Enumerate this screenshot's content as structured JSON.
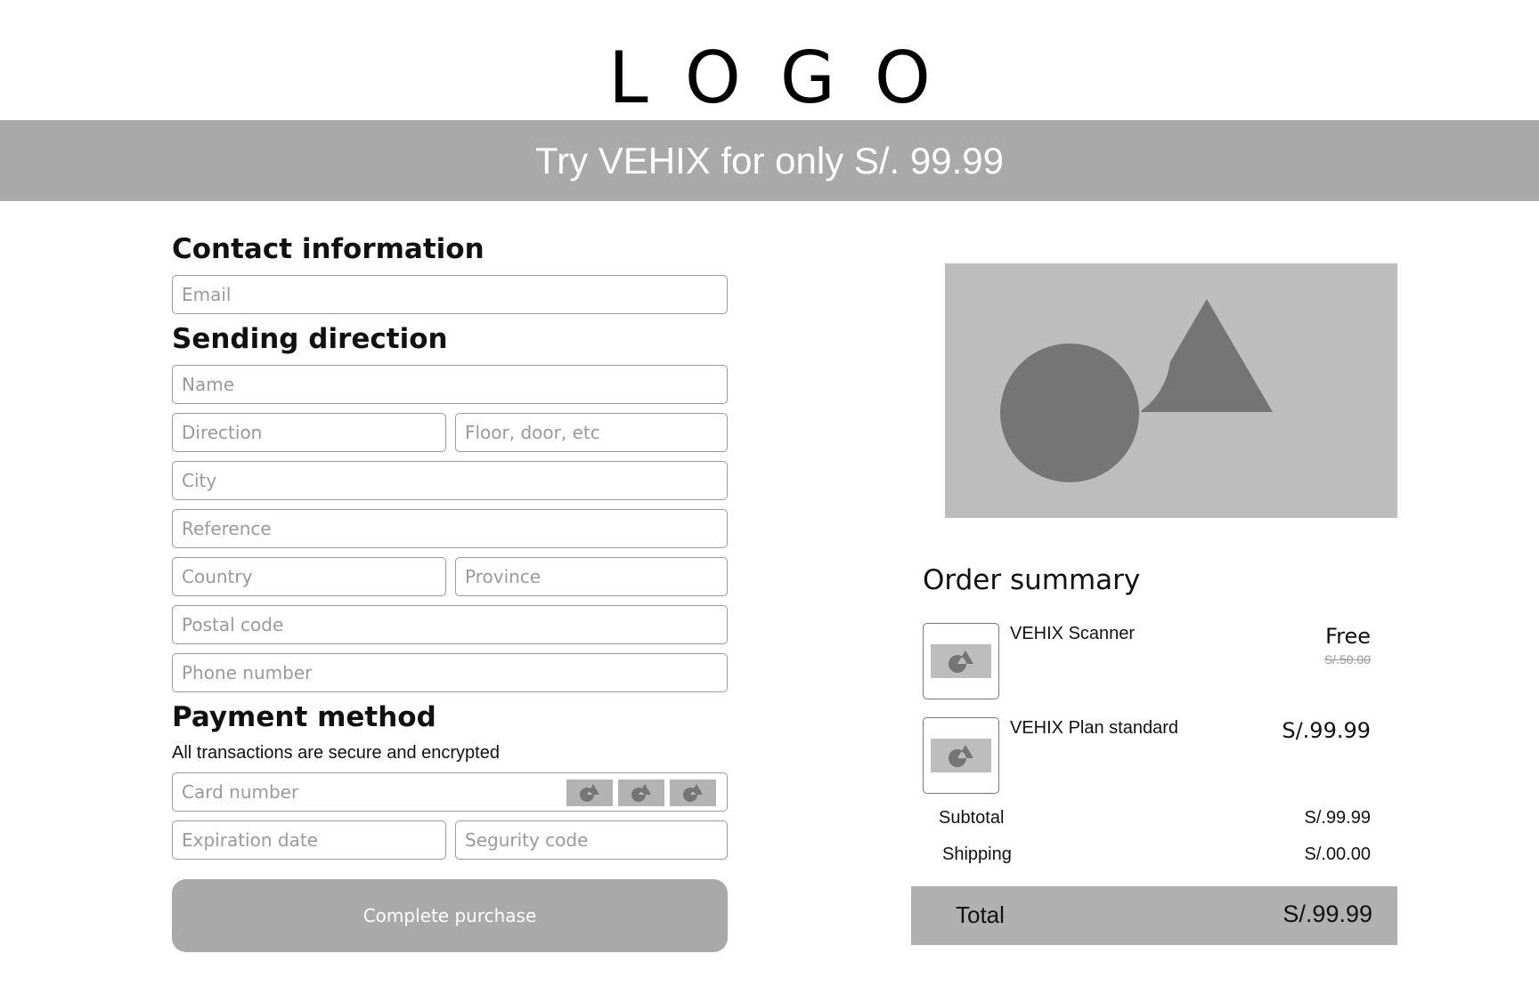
{
  "header": {
    "logo": "LOGO",
    "banner": "Try VEHIX for only S/. 99.99"
  },
  "contact": {
    "title": "Contact information",
    "email_placeholder": "Email"
  },
  "shipping": {
    "title": "Sending direction",
    "name_placeholder": "Name",
    "direction_placeholder": "Direction",
    "floor_placeholder": "Floor, door, etc",
    "city_placeholder": "City",
    "reference_placeholder": "Reference",
    "country_placeholder": "Country",
    "province_placeholder": "Province",
    "postal_placeholder": "Postal code",
    "phone_placeholder": "Phone number"
  },
  "payment": {
    "title": "Payment method",
    "subtitle": "All transactions are secure and encrypted",
    "card_placeholder": "Card number",
    "expiration_placeholder": "Expiration date",
    "security_placeholder": "Segurity code",
    "submit_label": "Complete purchase"
  },
  "summary": {
    "title": "Order summary",
    "items": [
      {
        "name": "VEHIX Scanner",
        "price": "Free",
        "original_price": "S/.50.00"
      },
      {
        "name": "VEHIX Plan standard",
        "price": "S/.99.99"
      }
    ],
    "subtotal_label": "Subtotal",
    "subtotal_value": "S/.99.99",
    "shipping_label": "Shipping",
    "shipping_value": "S/.00.00",
    "total_label": "Total",
    "total_value": "S/.99.99"
  },
  "colors": {
    "banner": "#a9a9a9",
    "placeholder_shape": "#757575",
    "placeholder_bg": "#bdbdbd"
  }
}
